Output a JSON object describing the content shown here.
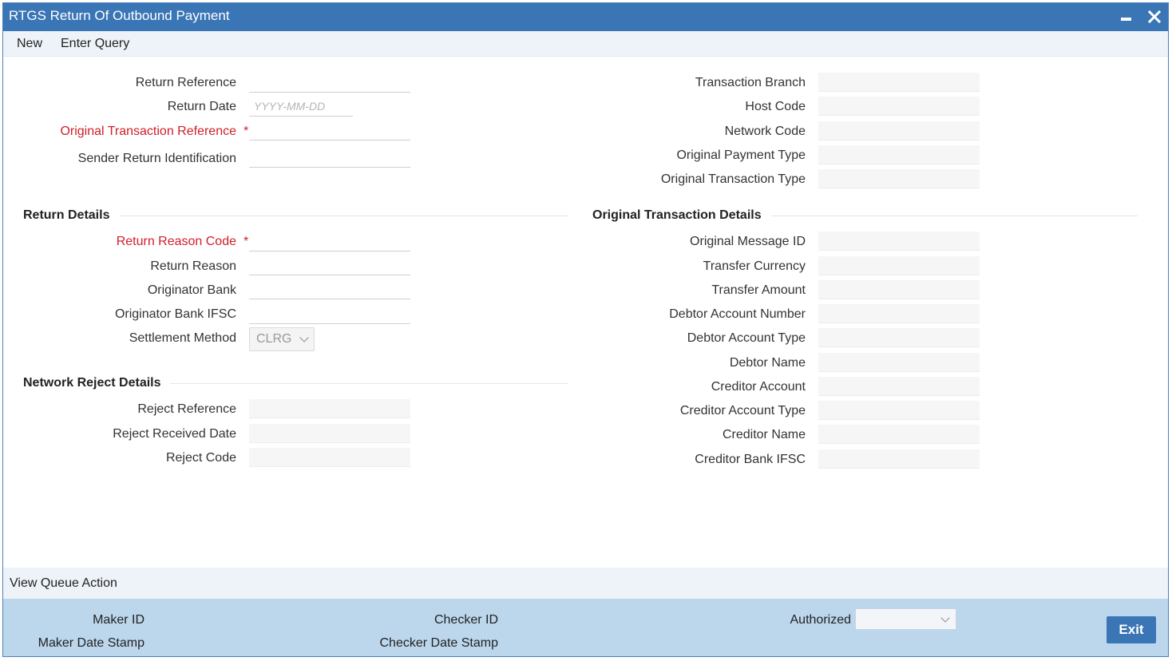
{
  "window": {
    "title": "RTGS Return Of Outbound Payment"
  },
  "menu": {
    "new_label": "New",
    "enter_query_label": "Enter Query"
  },
  "header_left": {
    "return_reference": {
      "label": "Return Reference",
      "value": ""
    },
    "return_date": {
      "label": "Return Date",
      "placeholder": "YYYY-MM-DD",
      "value": ""
    },
    "original_transaction_reference": {
      "label": "Original Transaction Reference",
      "required": true,
      "value": ""
    },
    "sender_return_identification": {
      "label": "Sender Return Identification",
      "value": ""
    }
  },
  "header_right": {
    "transaction_branch": {
      "label": "Transaction Branch",
      "value": ""
    },
    "host_code": {
      "label": "Host Code",
      "value": ""
    },
    "network_code": {
      "label": "Network Code",
      "value": ""
    },
    "original_payment_type": {
      "label": "Original Payment Type",
      "value": ""
    },
    "original_transaction_type": {
      "label": "Original Transaction Type",
      "value": ""
    }
  },
  "return_details": {
    "heading": "Return Details",
    "return_reason_code": {
      "label": "Return Reason Code",
      "required": true,
      "value": ""
    },
    "return_reason": {
      "label": "Return Reason",
      "value": ""
    },
    "originator_bank": {
      "label": "Originator Bank",
      "value": ""
    },
    "originator_bank_ifsc": {
      "label": "Originator Bank IFSC",
      "value": ""
    },
    "settlement_method": {
      "label": "Settlement Method",
      "value": "CLRG"
    }
  },
  "network_reject_details": {
    "heading": "Network Reject Details",
    "reject_reference": {
      "label": "Reject Reference",
      "value": ""
    },
    "reject_received_date": {
      "label": "Reject Received Date",
      "value": ""
    },
    "reject_code": {
      "label": "Reject Code",
      "value": ""
    }
  },
  "original_transaction_details": {
    "heading": "Original Transaction Details",
    "original_message_id": {
      "label": "Original Message ID",
      "value": ""
    },
    "transfer_currency": {
      "label": "Transfer Currency",
      "value": ""
    },
    "transfer_amount": {
      "label": "Transfer Amount",
      "value": ""
    },
    "debtor_account_number": {
      "label": "Debtor Account Number",
      "value": ""
    },
    "debtor_account_type": {
      "label": "Debtor Account Type",
      "value": ""
    },
    "debtor_name": {
      "label": "Debtor Name",
      "value": ""
    },
    "creditor_account": {
      "label": "Creditor Account",
      "value": ""
    },
    "creditor_account_type": {
      "label": "Creditor Account Type",
      "value": ""
    },
    "creditor_name": {
      "label": "Creditor Name",
      "value": ""
    },
    "creditor_bank_ifsc": {
      "label": "Creditor Bank IFSC",
      "value": ""
    }
  },
  "queue": {
    "view_queue_action_label": "View Queue Action"
  },
  "footer": {
    "maker_id_label": "Maker ID",
    "maker_date_stamp_label": "Maker Date Stamp",
    "checker_id_label": "Checker ID",
    "checker_date_stamp_label": "Checker Date Stamp",
    "authorized_label": "Authorized",
    "authorized_value": "",
    "exit_label": "Exit"
  },
  "colors": {
    "title_bar": "#3a75b6",
    "required_label": "#d0202a",
    "footer_bg": "#bcd6ec",
    "menu_bg": "#eef3f9"
  }
}
